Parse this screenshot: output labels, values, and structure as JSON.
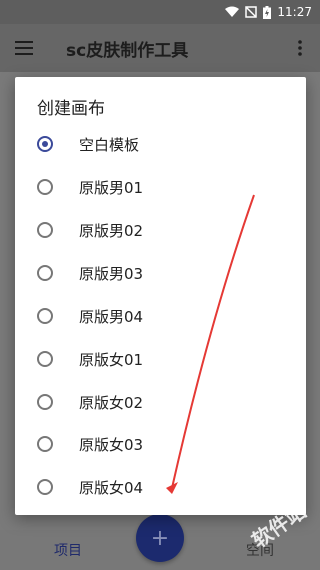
{
  "status_bar": {
    "time": "11:27"
  },
  "app_bar": {
    "title": "sc皮肤制作工具"
  },
  "dialog": {
    "title": "创建画布",
    "options": [
      {
        "label": "空白模板",
        "checked": true
      },
      {
        "label": "原版男01",
        "checked": false
      },
      {
        "label": "原版男02",
        "checked": false
      },
      {
        "label": "原版男03",
        "checked": false
      },
      {
        "label": "原版男04",
        "checked": false
      },
      {
        "label": "原版女01",
        "checked": false
      },
      {
        "label": "原版女02",
        "checked": false
      },
      {
        "label": "原版女03",
        "checked": false
      },
      {
        "label": "原版女04",
        "checked": false
      }
    ]
  },
  "bottom_nav": {
    "projects": "项目",
    "space": "空间"
  },
  "fab": {
    "symbol": "+"
  },
  "watermark": "软件站",
  "colors": {
    "accent": "#3b4a9a",
    "fab": "#1c2a6e",
    "arrow": "#e53935"
  }
}
